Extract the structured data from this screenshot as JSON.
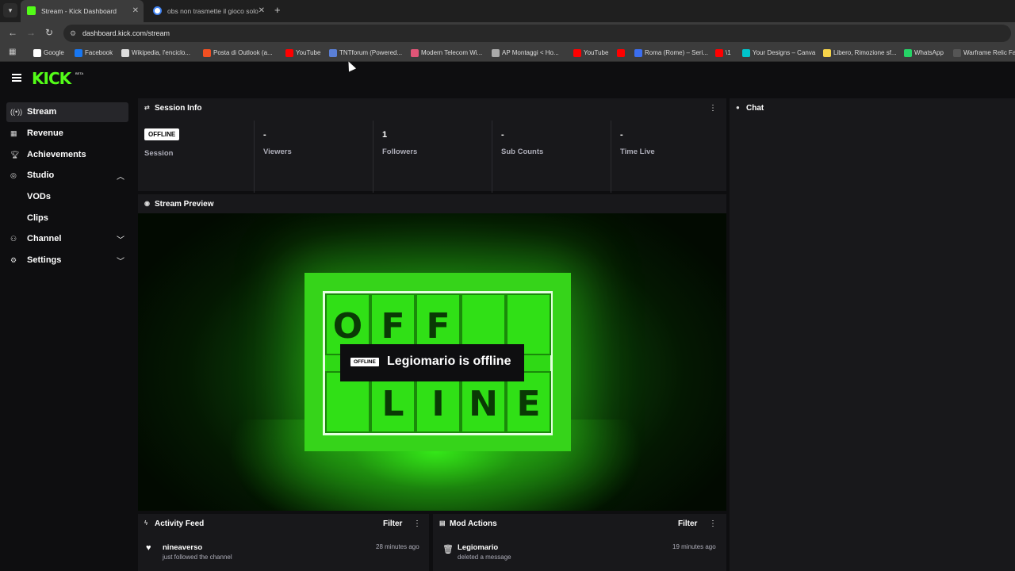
{
  "browser": {
    "tabs": [
      {
        "title": "Stream - Kick Dashboard",
        "close": "✕"
      },
      {
        "title": "obs non trasmette il gioco solo",
        "close": "✕"
      }
    ],
    "new_tab": "+",
    "url": "dashboard.kick.com/stream",
    "bookmarks": [
      {
        "label": "Google",
        "color": "#ffffff"
      },
      {
        "label": "Facebook",
        "color": "#1877f2"
      },
      {
        "label": "Wikipedia, l'enciclo...",
        "color": "#dddddd"
      },
      {
        "label": "Posta di Outlook (a...",
        "color": "#f25022"
      },
      {
        "label": "YouTube",
        "color": "#ff0000"
      },
      {
        "label": "TNTforum (Powered...",
        "color": "#5a7fd6"
      },
      {
        "label": "Modern Telecom Wi...",
        "color": "#e05577"
      },
      {
        "label": "AP Montaggi < Ho...",
        "color": "#aaaaaa"
      },
      {
        "label": "YouTube",
        "color": "#ff0000"
      },
      {
        "label": "",
        "color": "#ff0000"
      },
      {
        "label": "Roma (Rome) – Seri...",
        "color": "#3b6ef0"
      },
      {
        "label": "\\1",
        "color": "#ff0000"
      },
      {
        "label": "Your Designs – Canva",
        "color": "#00c4cc"
      },
      {
        "label": "Libero, Rimozione sf...",
        "color": "#f7d44a"
      },
      {
        "label": "WhatsApp",
        "color": "#25d366"
      },
      {
        "label": "Warframe Relic Fa",
        "color": "#555555"
      }
    ]
  },
  "app": {
    "logo": "KICK",
    "logo_sup": "BETA",
    "accent": "#53fc18"
  },
  "sidebar": {
    "items": [
      {
        "label": "Stream",
        "icon": "broadcast-icon"
      },
      {
        "label": "Revenue",
        "icon": "revenue-icon"
      },
      {
        "label": "Achievements",
        "icon": "trophy-icon"
      },
      {
        "label": "Studio",
        "icon": "studio-icon"
      },
      {
        "label": "VODs"
      },
      {
        "label": "Clips"
      },
      {
        "label": "Channel",
        "icon": "channel-icon"
      },
      {
        "label": "Settings",
        "icon": "gear-icon"
      }
    ]
  },
  "session_info": {
    "title": "Session Info",
    "badge": "OFFLINE",
    "session_label": "Session",
    "stats": [
      {
        "value": "-",
        "label": "Viewers"
      },
      {
        "value": "1",
        "label": "Followers"
      },
      {
        "value": "-",
        "label": "Sub Counts"
      },
      {
        "value": "-",
        "label": "Time Live"
      }
    ]
  },
  "chat": {
    "title": "Chat"
  },
  "preview": {
    "title": "Stream Preview",
    "badge": "OFFLINE",
    "message": "Legiomario is offline",
    "board_letters": [
      "O",
      "F",
      "F",
      "",
      "",
      "",
      "L",
      "I",
      "N",
      "E"
    ]
  },
  "activity_feed": {
    "title": "Activity Feed",
    "filter": "Filter",
    "entry": {
      "name": "nineaverso",
      "text": "just followed the channel",
      "time": "28 minutes ago"
    }
  },
  "mod_actions": {
    "title": "Mod Actions",
    "filter": "Filter",
    "entry": {
      "name": "Legiomario",
      "text": "deleted a message",
      "time": "19 minutes ago"
    }
  }
}
